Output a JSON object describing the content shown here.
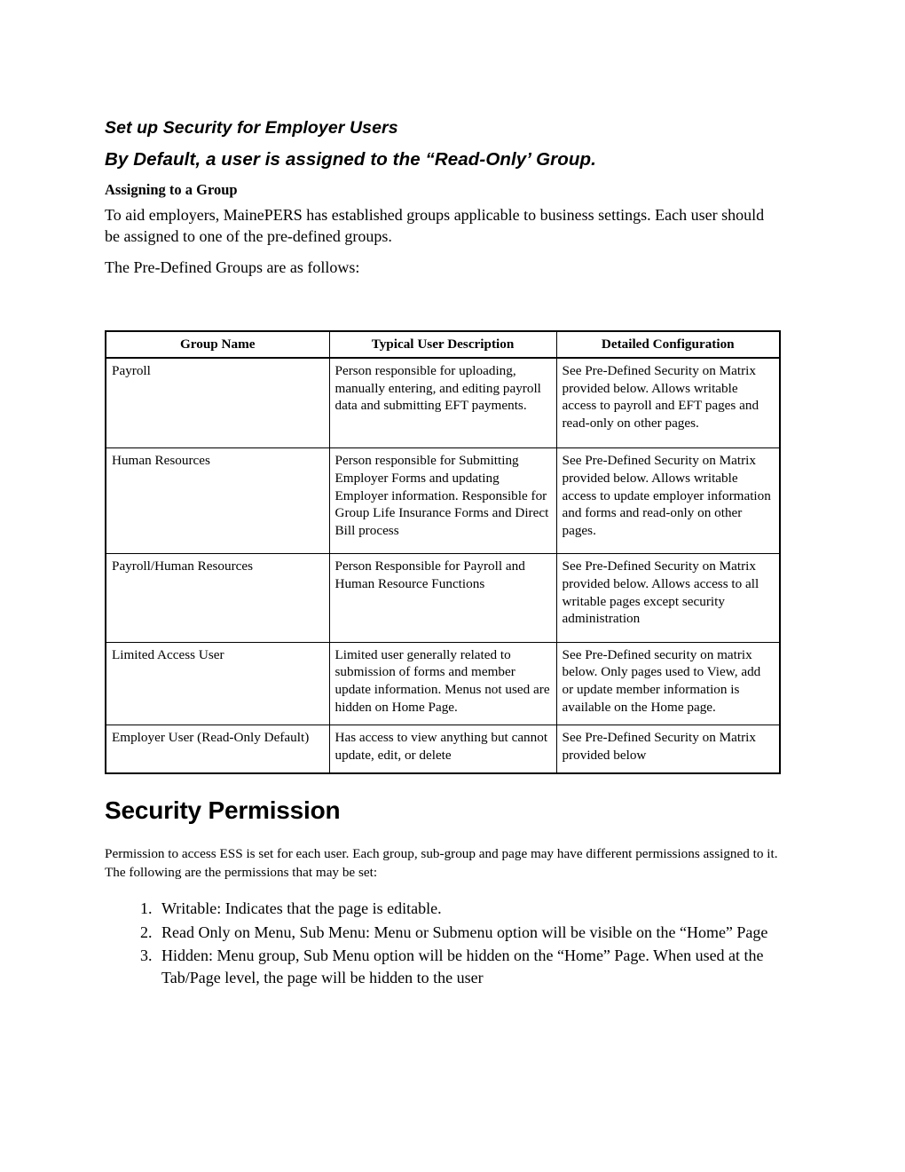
{
  "document": {
    "title": "Set up Security for Employer Users",
    "subtitle": "By Default, a user is assigned to the “Read-Only’ Group.",
    "section_heading": "Assigning to a Group",
    "intro_paragraph": "To aid employers, MainePERS has established groups applicable to business settings.  Each user should be assigned to one of the pre-defined groups.",
    "lead_in": "The Pre-Defined Groups are as follows:"
  },
  "table": {
    "headers": [
      "Group Name",
      "Typical User Description",
      "Detailed Configuration"
    ],
    "rows": [
      {
        "group_name": "Payroll",
        "typical_user_description": "Person responsible for uploading, manually entering, and editing payroll data and submitting EFT payments.",
        "detailed_configuration": "See Pre-Defined Security on Matrix provided below. Allows writable access to payroll and EFT pages and read-only on other pages."
      },
      {
        "group_name": "Human Resources",
        "typical_user_description": "Person responsible for Submitting Employer Forms and updating Employer information. Responsible for Group Life Insurance Forms and Direct Bill process",
        "detailed_configuration": "See Pre-Defined Security on Matrix provided below. Allows writable access to update employer information and forms and read-only on other pages."
      },
      {
        "group_name": "Payroll/Human Resources",
        "typical_user_description": "Person Responsible for Payroll and Human Resource Functions",
        "detailed_configuration": "See Pre-Defined Security on Matrix provided below. Allows access to all writable pages except security administration"
      },
      {
        "group_name": "Limited Access User",
        "typical_user_description": "Limited user generally related to submission of forms and member update information.  Menus not used are hidden on Home Page.",
        "detailed_configuration": "See Pre-Defined security on matrix below. Only pages used to View, add or update member information is available on the Home page."
      },
      {
        "group_name": "Employer User (Read-Only Default)",
        "typical_user_description": "Has access to view anything but cannot update, edit, or delete",
        "detailed_configuration": "See Pre-Defined Security on Matrix provided below"
      }
    ]
  },
  "security_permission": {
    "heading": "Security Permission",
    "paragraph": "Permission to access ESS is set for each user.  Each group, sub-group and page may have different permissions assigned to it.  The following are the permissions that may be set:",
    "items": [
      "Writable: Indicates that the page is editable.",
      "Read Only on Menu, Sub Menu: Menu or Submenu option will be visible on the “Home” Page",
      "Hidden: Menu group, Sub Menu option will be hidden on the “Home” Page. When used at the Tab/Page level, the page will be hidden to the user"
    ]
  }
}
